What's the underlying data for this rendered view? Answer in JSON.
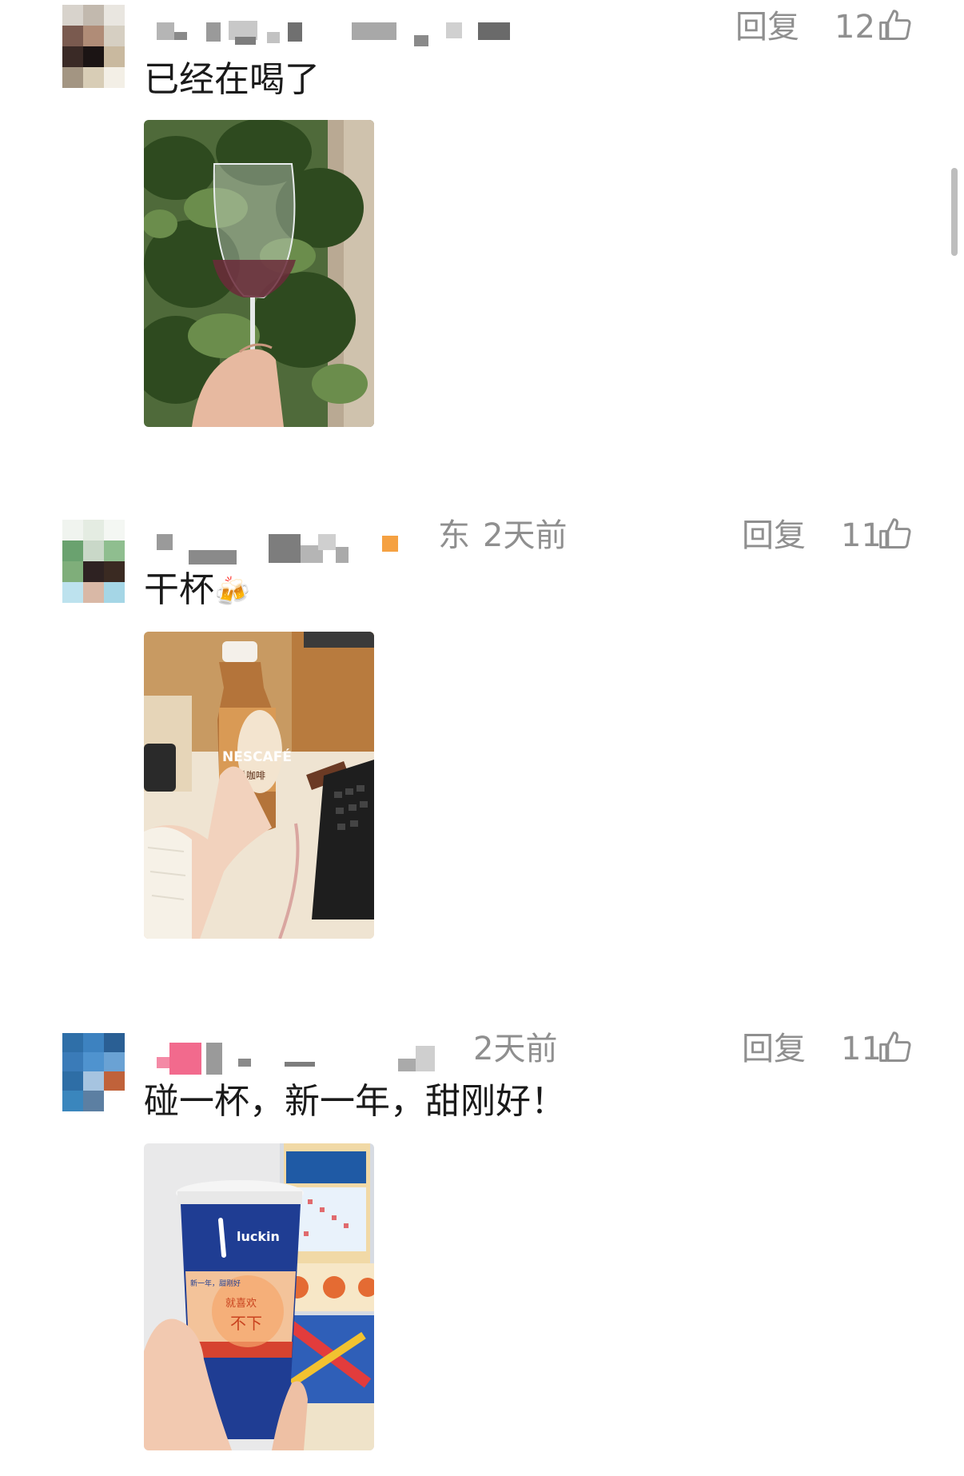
{
  "comments": [
    {
      "text": "已经在喝了",
      "meta": "",
      "reply_label": "回复",
      "likes": "12",
      "photo_subject": "red wine glass held in front of green plant"
    },
    {
      "text": "干杯",
      "emoji": "🍻",
      "meta_location": "东",
      "meta_time": "2天前",
      "reply_label": "回复",
      "likes": "11",
      "photo_subject": "hand holding bottled coffee at desk with keyboard",
      "bottle_brand": "NESCAFÉ",
      "bottle_label": "雀巢咖啡"
    },
    {
      "text": "碰一杯，新一年，甜刚好！",
      "meta_time": "2天前",
      "reply_label": "回复",
      "likes": "11",
      "photo_subject": "hand holding luckin coffee cup",
      "cup_brand": "luckin",
      "cup_slogan": "不下",
      "cup_slogan_top": "就喜欢",
      "cup_banner": "新一年，甜刚好"
    }
  ],
  "icons": {
    "like": "thumbs-up-icon",
    "scrollbar": "scrollbar"
  },
  "colors": {
    "meta_gray": "#8f8f8f",
    "text_dark": "#1a1a1a",
    "badge_orange": "#f5a142",
    "badge_pink": "#f26a8d"
  }
}
